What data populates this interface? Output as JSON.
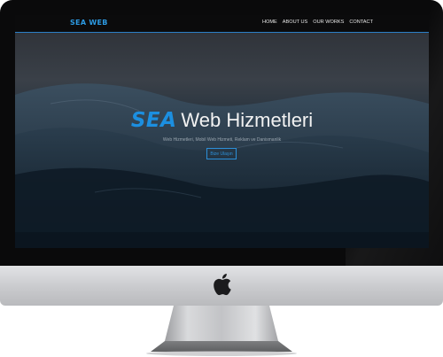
{
  "brand": {
    "logo_text": "SEA WEB"
  },
  "nav": {
    "items": [
      {
        "label": "HOME"
      },
      {
        "label": "ABOUT US"
      },
      {
        "label": "OUR WORKS"
      },
      {
        "label": "CONTACT"
      }
    ]
  },
  "hero": {
    "title_brand": "SEA",
    "title_rest": "Web Hizmetleri",
    "subtitle": "Web Hizmetleri, Mobil Web Hizmeti, Reklam ve Danismanlik",
    "button_label": "Bize Ulaşın"
  },
  "colors": {
    "accent": "#1c8fe0",
    "navbar": "#0b0b0c",
    "bezel": "#0a0a0b",
    "chin": "#d4d5d8"
  },
  "icons": {
    "chin_logo": "apple-icon"
  }
}
